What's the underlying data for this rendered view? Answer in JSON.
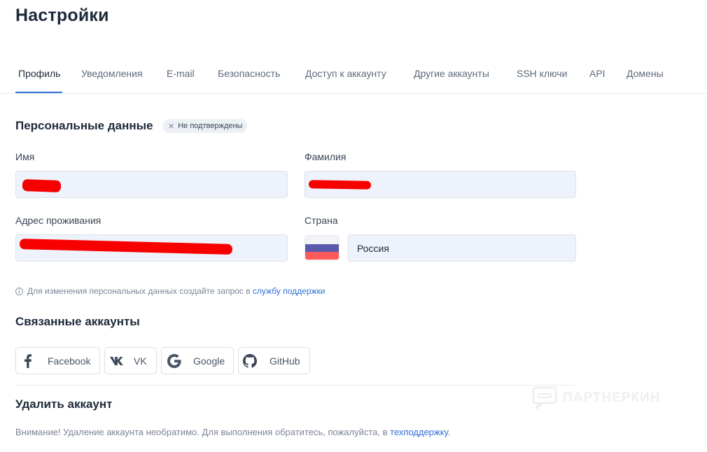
{
  "header": {
    "title": "Настройки"
  },
  "tabs": [
    {
      "label": "Профиль",
      "active": true
    },
    {
      "label": "Уведомления"
    },
    {
      "label": "E-mail"
    },
    {
      "label": "Безопасность"
    },
    {
      "label": "Доступ к аккаунту"
    },
    {
      "label": "Другие аккаунты"
    },
    {
      "label": "SSH ключи"
    },
    {
      "label": "API"
    },
    {
      "label": "Домены"
    }
  ],
  "personal": {
    "title": "Персональные данные",
    "badge": {
      "icon": "close-icon",
      "text": "Не подтверждены"
    },
    "first_name": {
      "label": "Имя",
      "value": ""
    },
    "last_name": {
      "label": "Фамилия",
      "value": ""
    },
    "address": {
      "label": "Адрес проживания",
      "value": ""
    },
    "country": {
      "label": "Страна",
      "value": "Россия",
      "flag": "russia-flag-icon"
    },
    "info": {
      "icon": "info-icon",
      "text": "Для изменения персональных данных создайте запрос в",
      "link": "службу поддержки"
    }
  },
  "linked": {
    "title": "Связанные аккаунты",
    "buttons": [
      {
        "label": "Facebook",
        "icon": "facebook-icon"
      },
      {
        "label": "VK",
        "icon": "vk-icon"
      },
      {
        "label": "Google",
        "icon": "google-icon"
      },
      {
        "label": "GitHub",
        "icon": "github-icon"
      }
    ]
  },
  "delete": {
    "title": "Удалить аккаунт",
    "warning": "Внимание! Удаление аккаунта необратимо. Для выполнения обратитесь, пожалуйста, в",
    "link": "техподдержку",
    "suffix": "."
  },
  "watermark": {
    "text": "ПАРТНЕРКИН"
  },
  "colors": {
    "accent": "#2f6fd6",
    "redaction": "#f90000",
    "field_bg": "#edf2fb"
  }
}
